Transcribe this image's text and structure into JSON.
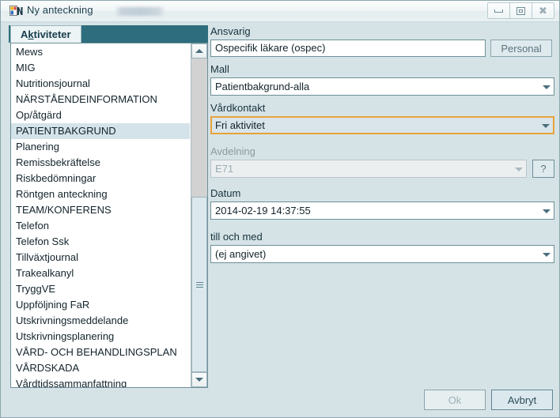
{
  "window": {
    "title": "Ny anteckning",
    "icon": "app-window-icon",
    "redacted_label": "",
    "controls": {
      "minimize": "minimize-icon",
      "maximize": "restore-icon",
      "close": "close-icon"
    }
  },
  "left_panel": {
    "tab": {
      "label_before": "A",
      "label_accel": "k",
      "label_after": "tiviteter",
      "full_label": "Aktiviteter"
    },
    "selected_item": "PATIENTBAKGRUND",
    "items": [
      "Mews",
      "MIG",
      "Nutritionsjournal",
      "NÄRSTÅENDEINFORMATION",
      "Op/åtgärd",
      "PATIENTBAKGRUND",
      "Planering",
      "Remissbekräftelse",
      "Riskbedömningar",
      "Röntgen anteckning",
      "TEAM/KONFERENS",
      "Telefon",
      "Telefon Ssk",
      "Tillväxtjournal",
      "Trakealkanyl",
      "TryggVE",
      "Uppföljning FaR",
      "Utskrivningsmeddelande",
      "Utskrivningsplanering",
      "VÅRD- OCH BEHANDLINGSPLAN",
      "VÅRDSKADA",
      "Vårdtidssammanfattning"
    ],
    "scrollbar": {
      "up_arrow": "scroll-up-icon",
      "down_arrow": "scroll-down-icon",
      "grip": "scrollbar-grip-icon"
    }
  },
  "form": {
    "ansvarig": {
      "label": "Ansvarig",
      "value": "Ospecifik läkare (ospec)",
      "button": "Personal"
    },
    "mall": {
      "label": "Mall",
      "value": "Patientbakgrund-alla"
    },
    "vardkontakt": {
      "label": "Vårdkontakt",
      "value": "Fri aktivitet"
    },
    "avdelning": {
      "label": "Avdelning",
      "value": "E71",
      "help_button": "?"
    },
    "datum": {
      "label": "Datum",
      "value": "2014-02-19 14:37:55"
    },
    "till_och_med": {
      "label": "till och med",
      "value": "(ej angivet)"
    }
  },
  "footer": {
    "ok": "Ok",
    "cancel": "Avbryt"
  },
  "colors": {
    "dialog_background": "#d6e3e6",
    "tabstrip": "#2e6d7d",
    "selection": "#d4e2e9",
    "focus_border": "#e7a33a",
    "field_border": "#6e8f99"
  }
}
